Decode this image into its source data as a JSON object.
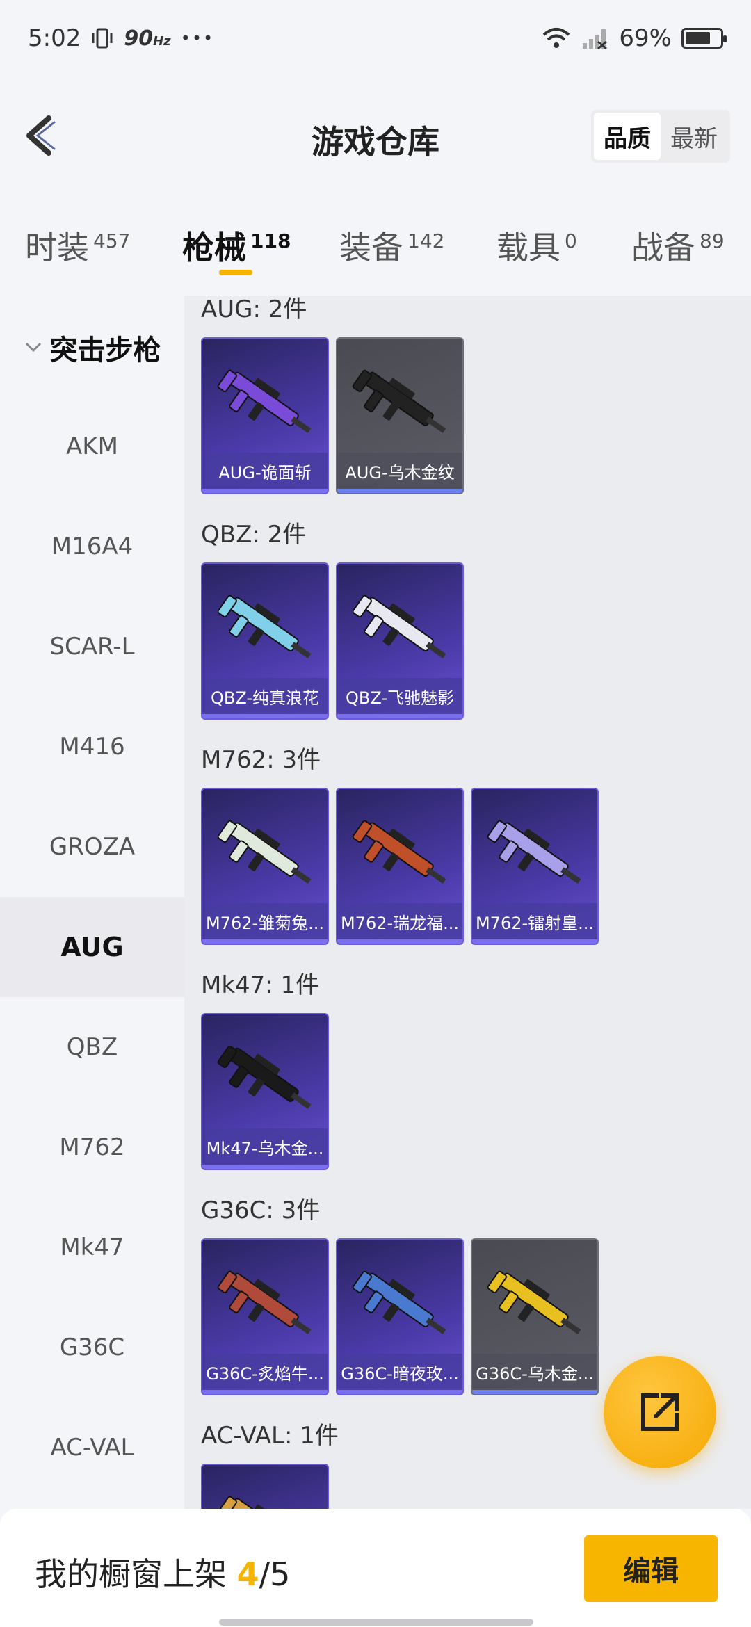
{
  "status": {
    "time": "5:02",
    "hz": "90",
    "hz_unit": "Hz",
    "dots": "•••",
    "battery": "69%",
    "battery_level": 0.69
  },
  "header": {
    "title": "游戏仓库",
    "sort_options": [
      "品质",
      "最新"
    ],
    "active_sort": "品质"
  },
  "categories": [
    {
      "label": "时装",
      "count": "457"
    },
    {
      "label": "枪械",
      "count": "118"
    },
    {
      "label": "装备",
      "count": "142"
    },
    {
      "label": "载具",
      "count": "0"
    },
    {
      "label": "战备",
      "count": "89"
    }
  ],
  "sidebar": {
    "group": "突击步枪",
    "items": [
      "AKM",
      "M16A4",
      "SCAR-L",
      "M416",
      "GROZA",
      "AUG",
      "QBZ",
      "M762",
      "Mk47",
      "G36C",
      "AC-VAL"
    ],
    "active": "AUG"
  },
  "sections": [
    {
      "title": "AUG: 2件",
      "items": [
        {
          "name": "AUG-诡面斩",
          "tier": "purple",
          "gun_color": "#7a4ad8"
        },
        {
          "name": "AUG-乌木金纹",
          "tier": "gold",
          "gun_color": "#222222"
        }
      ]
    },
    {
      "title": "QBZ: 2件",
      "items": [
        {
          "name": "QBZ-纯真浪花",
          "tier": "purple",
          "gun_color": "#7fd0e8"
        },
        {
          "name": "QBZ-飞驰魅影",
          "tier": "purple",
          "gun_color": "#e8e8f0"
        }
      ]
    },
    {
      "title": "M762: 3件",
      "items": [
        {
          "name": "M762-雏菊兔...",
          "tier": "purple",
          "gun_color": "#e0eadc"
        },
        {
          "name": "M762-瑞龙福...",
          "tier": "purple",
          "gun_color": "#c0502a"
        },
        {
          "name": "M762-镭射皇...",
          "tier": "purple",
          "gun_color": "#a8a0e8"
        }
      ]
    },
    {
      "title": "Mk47: 1件",
      "items": [
        {
          "name": "Mk47-乌木金...",
          "tier": "purple",
          "gun_color": "#1a1a1a"
        }
      ]
    },
    {
      "title": "G36C: 3件",
      "items": [
        {
          "name": "G36C-炙焰牛...",
          "tier": "purple",
          "gun_color": "#b04a3a"
        },
        {
          "name": "G36C-暗夜玫...",
          "tier": "purple",
          "gun_color": "#4a7ad0"
        },
        {
          "name": "G36C-乌木金...",
          "tier": "gold",
          "gun_color": "#e8c020"
        }
      ]
    },
    {
      "title": "AC-VAL: 1件",
      "items": [
        {
          "name": "",
          "tier": "purple",
          "gun_color": "#d8a040"
        }
      ]
    }
  ],
  "footer": {
    "showcase_label": "我的橱窗上架",
    "showcase_count": "4",
    "showcase_total": "/5",
    "edit_label": "编辑"
  },
  "colors": {
    "accent": "#f5b400"
  }
}
